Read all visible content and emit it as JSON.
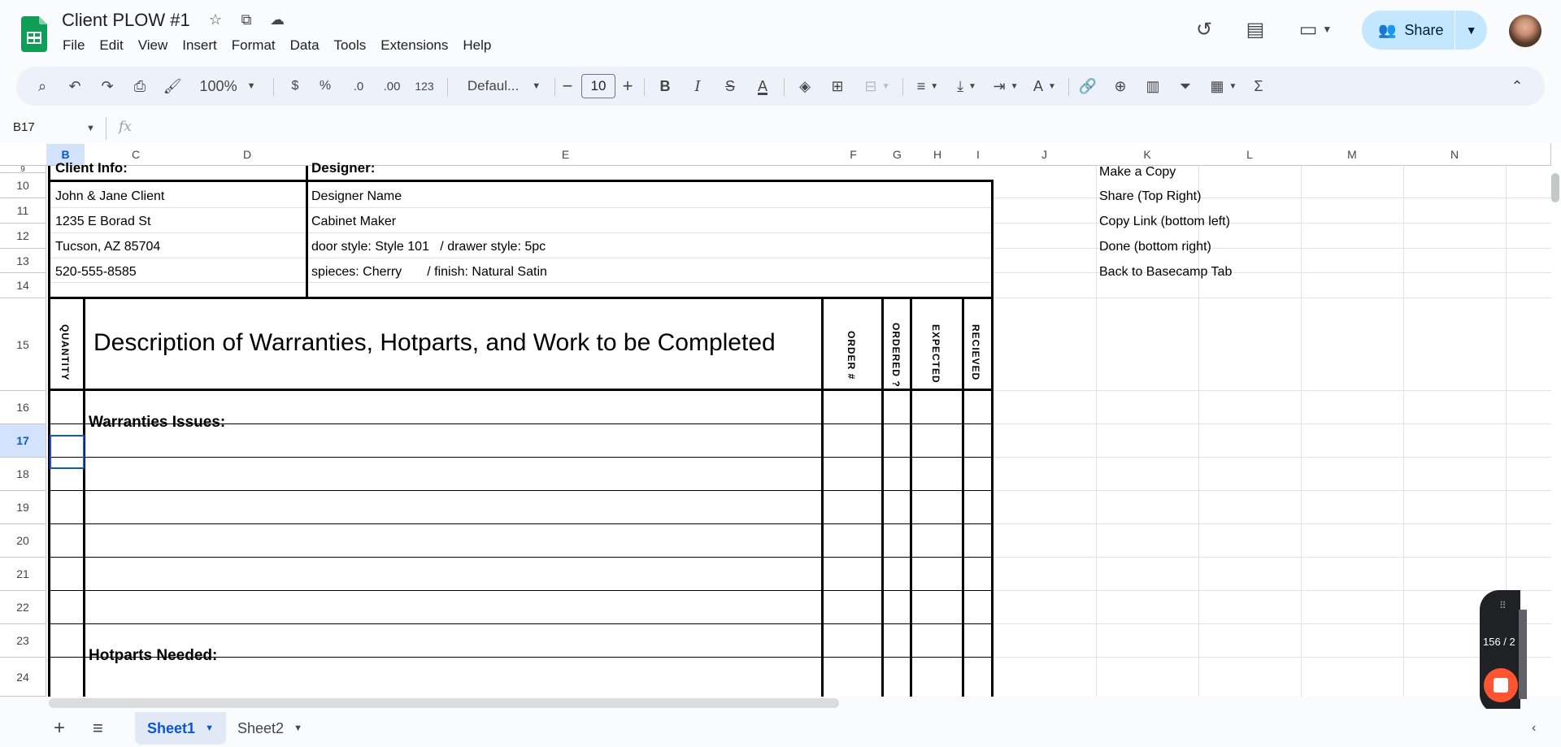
{
  "header": {
    "doc_title": "Client PLOW #1",
    "menus": [
      "File",
      "Edit",
      "View",
      "Insert",
      "Format",
      "Data",
      "Tools",
      "Extensions",
      "Help"
    ],
    "share_label": "Share"
  },
  "toolbar": {
    "zoom": "100%",
    "currency": "$",
    "percent": "%",
    "dec_decrease": ".0",
    "dec_increase": ".00",
    "number_format": "123",
    "font_family": "Defaul...",
    "font_size": "10",
    "bold": "B",
    "italic": "I",
    "strike": "S",
    "text_color": "A",
    "sum": "Σ"
  },
  "formula_bar": {
    "name_box": "B17",
    "fx": "fx",
    "value": ""
  },
  "columns": [
    "B",
    "C",
    "D",
    "E",
    "F",
    "G",
    "H",
    "I",
    "J",
    "K",
    "L",
    "M",
    "N"
  ],
  "rows": [
    "9",
    "10",
    "11",
    "12",
    "13",
    "14",
    "15",
    "16",
    "17",
    "18",
    "19",
    "20",
    "21",
    "22",
    "23",
    "24"
  ],
  "sheet": {
    "client_info": "Client Info:",
    "designer": "Designer:",
    "client_lines": [
      "John & Jane Client",
      "1235 E Borad St",
      "Tucson, AZ 85704",
      "520-555-8585"
    ],
    "designer_lines": [
      "Designer Name",
      "Cabinet Maker",
      "door style: Style 101   / drawer style: 5pc",
      "spieces: Cherry       / finish: Natural Satin"
    ],
    "notes": [
      "Make a Copy",
      "Share (Top Right)",
      "Copy Link (bottom left)",
      "Done (bottom right)",
      "Back to Basecamp Tab"
    ],
    "quantity": "QUANTITY",
    "description": "Description of Warranties, Hotparts, and Work to be Completed",
    "order_no": "ORDER #",
    "ordered": "ORDERED ?",
    "expected": "EXPECTED",
    "received": "RECIEVED",
    "warranties": "Warranties Issues:",
    "hotparts": "Hotparts Needed:"
  },
  "tabs": {
    "sheet1": "Sheet1",
    "sheet2": "Sheet2"
  },
  "recorder": {
    "count": "156 / 2"
  },
  "colors": {
    "accent": "#0b57d0",
    "share_bg": "#c2e7ff",
    "record": "#ff5533"
  }
}
